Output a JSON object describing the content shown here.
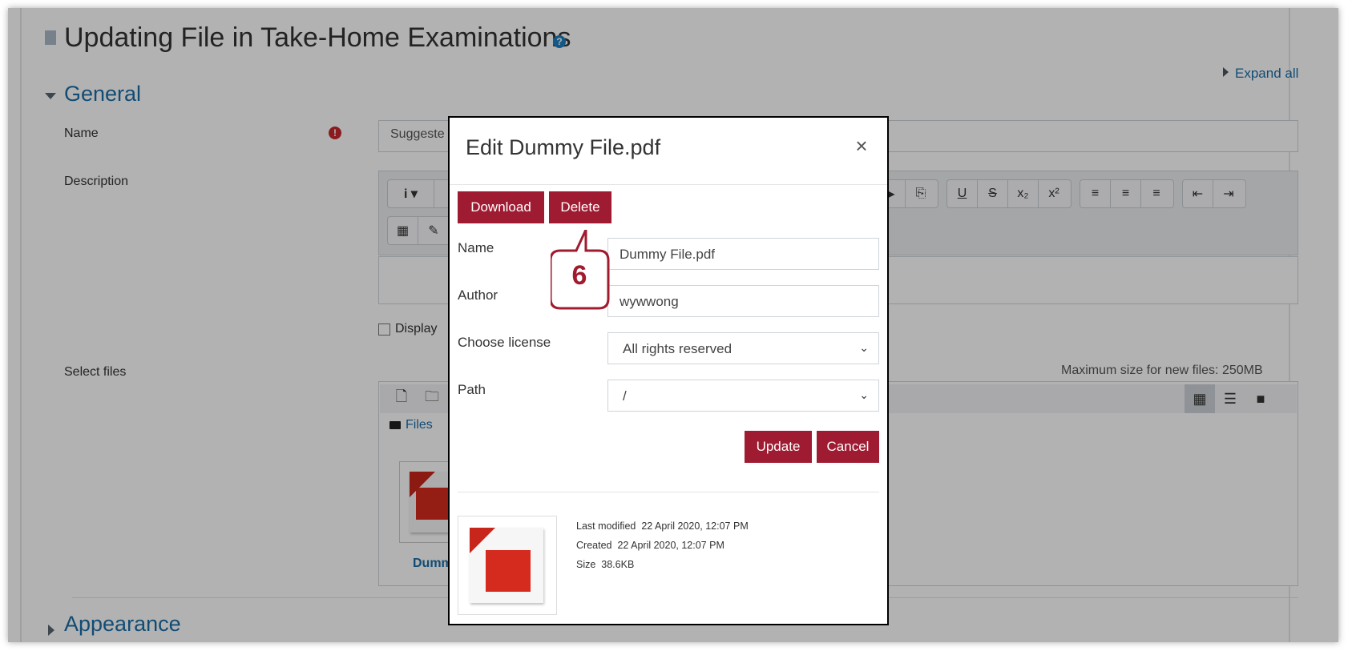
{
  "page": {
    "title": "Updating File in Take-Home Examinations",
    "help_glyph": "?",
    "expand_all": "Expand all",
    "general_heading": "General",
    "appearance_heading": "Appearance",
    "name_label": "Name",
    "name_value_partial": "Suggeste",
    "description_label": "Description",
    "display_partial": "Display",
    "select_files_label": "Select files",
    "max_size": "Maximum size for new files: 250MB",
    "files_breadcrumb": "Files",
    "file_name_partial": "Dumm",
    "toolbar_glyphs": {
      "info": "i ▾",
      "calc": "▦",
      "edit": "✎",
      "video": "▶",
      "paste": "⎘",
      "underline": "U",
      "strike": "S",
      "subscript": "x₂",
      "superscript": "x²",
      "align_left": "≡",
      "align_center": "≡",
      "align_right": "≡",
      "outdent": "⇤",
      "indent": "⇥"
    },
    "fm_glyphs": {
      "new_file": "🗋",
      "new_folder": "🗀",
      "grid": "▦",
      "list": "☰",
      "folder": "■"
    }
  },
  "modal": {
    "title": "Edit Dummy File.pdf",
    "close": "×",
    "download_label": "Download",
    "delete_label": "Delete",
    "name_label": "Name",
    "name_value": "Dummy File.pdf",
    "author_label": "Author",
    "author_value": "wywwong",
    "license_label": "Choose license",
    "license_value": "All rights reserved",
    "path_label": "Path",
    "path_value": "/",
    "chevron": "⌄",
    "update_label": "Update",
    "cancel_label": "Cancel",
    "meta": {
      "last_modified_label": "Last modified",
      "last_modified_value": "22 April 2020, 12:07 PM",
      "created_label": "Created",
      "created_value": "22 April 2020, 12:07 PM",
      "size_label": "Size",
      "size_value": "38.6KB"
    },
    "pdf_logo": "⅄"
  },
  "callout": {
    "number": "6"
  },
  "colors": {
    "accent_red": "#9f1b32",
    "link_blue": "#1a6ea8",
    "callout_border": "#a11b2f"
  }
}
